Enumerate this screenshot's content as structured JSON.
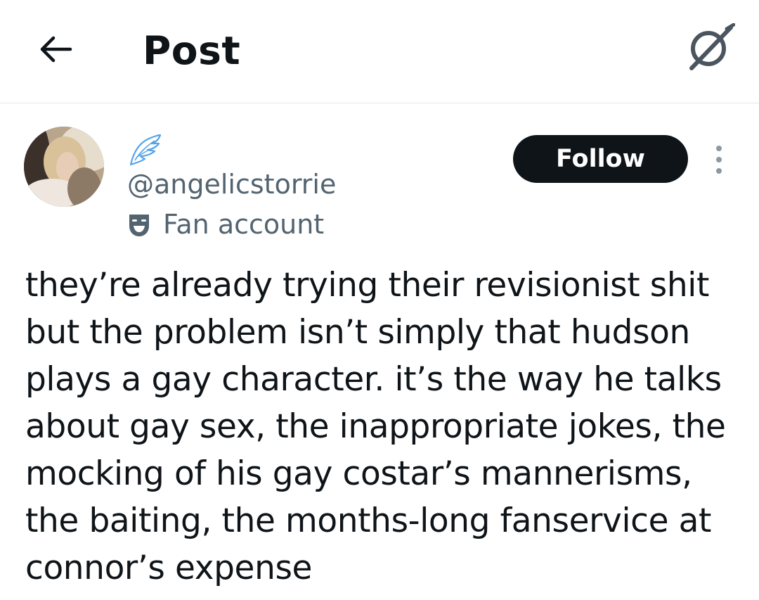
{
  "header": {
    "title": "Post",
    "back_icon": "arrow-left-icon",
    "grok_icon": "grok-icon"
  },
  "author": {
    "display_name_icon": "angel-wing-icon",
    "handle": "@angelicstorrie",
    "label_icon": "theater-mask-icon",
    "label": "Fan account",
    "follow_label": "Follow"
  },
  "post": {
    "text": "they’re already trying their revisionist shit\nbut the problem isn’t simply that hudson\nplays a gay character. it’s the way he talks\nabout gay sex, the inappropriate jokes, the\nmocking of his gay costar’s mannerisms,\nthe baiting, the months-long fanservice at\nconnor’s expense"
  },
  "colors": {
    "text_primary": "#0f1419",
    "text_secondary": "#536471",
    "follow_bg": "#0f1419",
    "divider": "#e3e6e8"
  }
}
